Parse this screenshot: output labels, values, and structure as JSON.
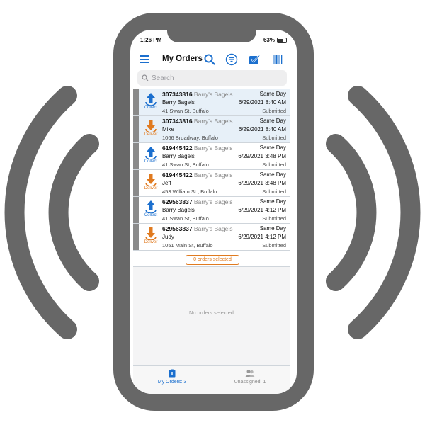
{
  "status_bar": {
    "time": "1:26 PM",
    "battery": "63%"
  },
  "header": {
    "title": "My Orders"
  },
  "search": {
    "placeholder": "Search"
  },
  "orders": [
    {
      "number": "307343816",
      "customer": "Barry's Bagels",
      "contact": "Barry Bagels",
      "address": "41 Swan St, Buffalo",
      "type": "Collect",
      "service": "Same Day",
      "datetime": "6/29/2021 8:40 AM",
      "status": "Submitted",
      "selected": true
    },
    {
      "number": "307343816",
      "customer": "Barry's Bagels",
      "contact": "Mike",
      "address": "1066 Broadway, Buffalo",
      "type": "Deliver",
      "service": "Same Day",
      "datetime": "6/29/2021 8:40 AM",
      "status": "Submitted",
      "selected": true
    },
    {
      "number": "619445422",
      "customer": "Barry's Bagels",
      "contact": "Barry Bagels",
      "address": "41 Swan St, Buffalo",
      "type": "Collect",
      "service": "Same Day",
      "datetime": "6/29/2021 3:48 PM",
      "status": "Submitted",
      "selected": false
    },
    {
      "number": "619445422",
      "customer": "Barry's Bagels",
      "contact": "Jeff",
      "address": "453 William St., Buffalo",
      "type": "Deliver",
      "service": "Same Day",
      "datetime": "6/29/2021 3:48 PM",
      "status": "Submitted",
      "selected": false
    },
    {
      "number": "629563837",
      "customer": "Barry's Bagels",
      "contact": "Barry Bagels",
      "address": "41 Swan St, Buffalo",
      "type": "Collect",
      "service": "Same Day",
      "datetime": "6/29/2021 4:12 PM",
      "status": "Submitted",
      "selected": false
    },
    {
      "number": "629563837",
      "customer": "Barry's Bagels",
      "contact": "Judy",
      "address": "1051 Main St, Buffalo",
      "type": "Deliver",
      "service": "Same Day",
      "datetime": "6/29/2021 4:12 PM",
      "status": "Submitted",
      "selected": false
    }
  ],
  "selection": {
    "count_label": "0 orders selected"
  },
  "detail": {
    "empty_message": "No orders selected."
  },
  "tabs": [
    {
      "label": "My Orders: 3",
      "icon": "clipboard-icon",
      "active": true
    },
    {
      "label": "Unassigned: 1",
      "icon": "people-icon",
      "active": false
    }
  ],
  "colors": {
    "accent": "#1b6fce",
    "deliver": "#e07a1f",
    "frame": "#676767"
  }
}
